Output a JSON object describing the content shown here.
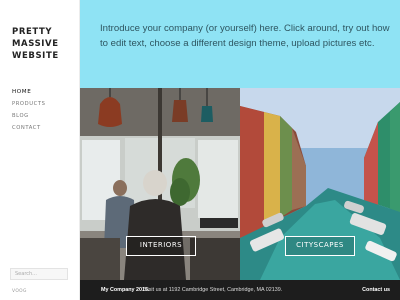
{
  "sidebar": {
    "title": "PRETTY MASSIVE WEBSITE",
    "nav": [
      "HOME",
      "PRODUCTS",
      "BLOG",
      "CONTACT"
    ],
    "search_placeholder": "Search...",
    "bottom_link": "VOOG"
  },
  "intro": {
    "text": "Introduce your company (or yourself) here. Click around, try out how to edit text, choose a different design theme, upload pictures etc.",
    "background": "#8fe3f4"
  },
  "gallery": {
    "interiors_label": "INTERIORS",
    "cityscapes_label": "CITYSCAPES"
  },
  "footer": {
    "company": "My Company 2015.",
    "address": "Visit us at 1192 Cambridge Street, Cambridge, MA 02139.",
    "contact": "Contact us"
  }
}
